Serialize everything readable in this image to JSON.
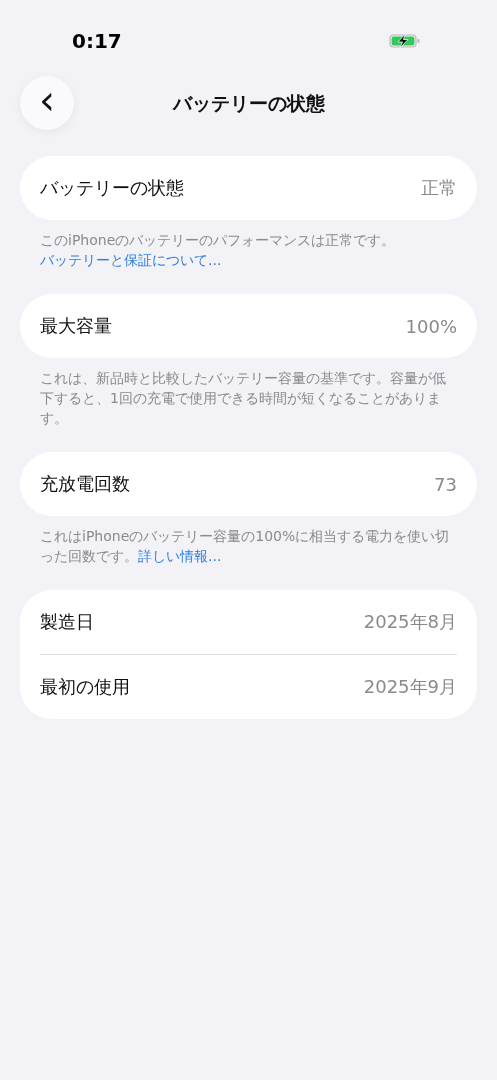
{
  "status_bar": {
    "time": "0:17",
    "charging": true
  },
  "nav": {
    "back": "‹",
    "title": "バッテリーの状態"
  },
  "groups": [
    {
      "rows": [
        {
          "label": "バッテリーの状態",
          "value": "正常"
        }
      ],
      "footer": {
        "text": "このiPhoneのバッテリーのパフォーマンスは正常です。",
        "link": "バッテリーと保証について..."
      }
    },
    {
      "rows": [
        {
          "label": "最大容量",
          "value": "100%"
        }
      ],
      "footer": {
        "text": "これは、新品時と比較したバッテリー容量の基準です。容量が低下すると、1回の充電で使用できる時間が短くなることがあります。"
      }
    },
    {
      "rows": [
        {
          "label": "充放電回数",
          "value": "73"
        }
      ],
      "footer": {
        "text": "これはiPhoneのバッテリー容量の100%に相当する電力を使い切った回数です。",
        "link": "詳しい情報..."
      }
    },
    {
      "rows": [
        {
          "label": "製造日",
          "value": "2025年8月"
        },
        {
          "label": "最初の使用",
          "value": "2025年9月"
        }
      ]
    }
  ]
}
